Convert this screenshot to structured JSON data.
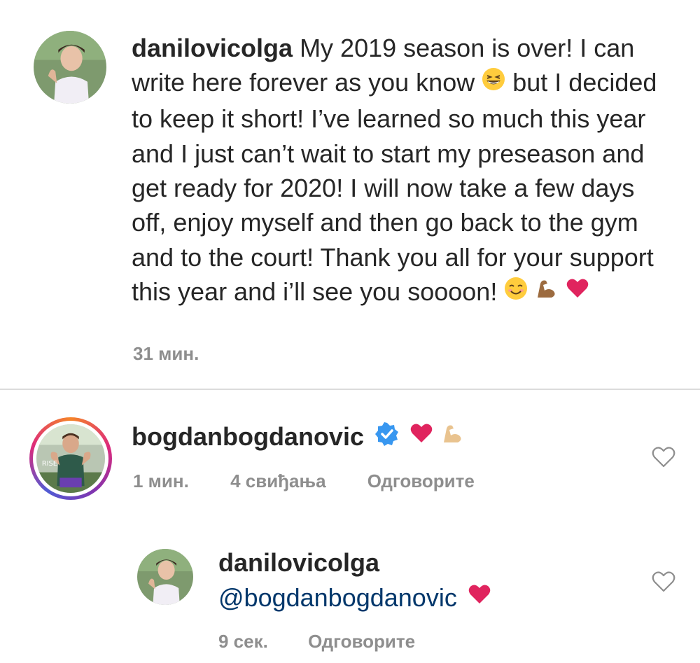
{
  "post": {
    "username": "danilovicolga",
    "caption_1": "My 2019 season is over! I can write here forever as you know",
    "caption_2": "but I decided to keep it short! I’ve learned so much this year and I just can’t wait to start my preseason and get ready for 2020! I will now take a few days off, enjoy myself and then go back to the gym and to the court! Thank you all for your support this year and i’ll see you soooon!",
    "time": "31 мин."
  },
  "comment": {
    "username": "bogdanbogdanovic",
    "time": "1 мин.",
    "likes": "4 свиђања",
    "reply_label": "Одговорите",
    "verified": true
  },
  "reply": {
    "username": "danilovicolga",
    "mention": "@bogdanbogdanovic",
    "time": "9 сек.",
    "reply_label": "Одговорите"
  },
  "colors": {
    "text": "#262626",
    "meta": "#8e8e8e",
    "heart": "#e0245e",
    "verified": "#3897f0",
    "mention": "#00376b",
    "divider": "#dbdbdb"
  },
  "icons": {
    "laugh": "grinning-squinting-face-icon",
    "smile": "smiling-face-icon",
    "muscle": "flexed-biceps-icon",
    "heart": "red-heart-icon",
    "like": "heart-outline-icon",
    "verified": "verified-badge-icon"
  }
}
